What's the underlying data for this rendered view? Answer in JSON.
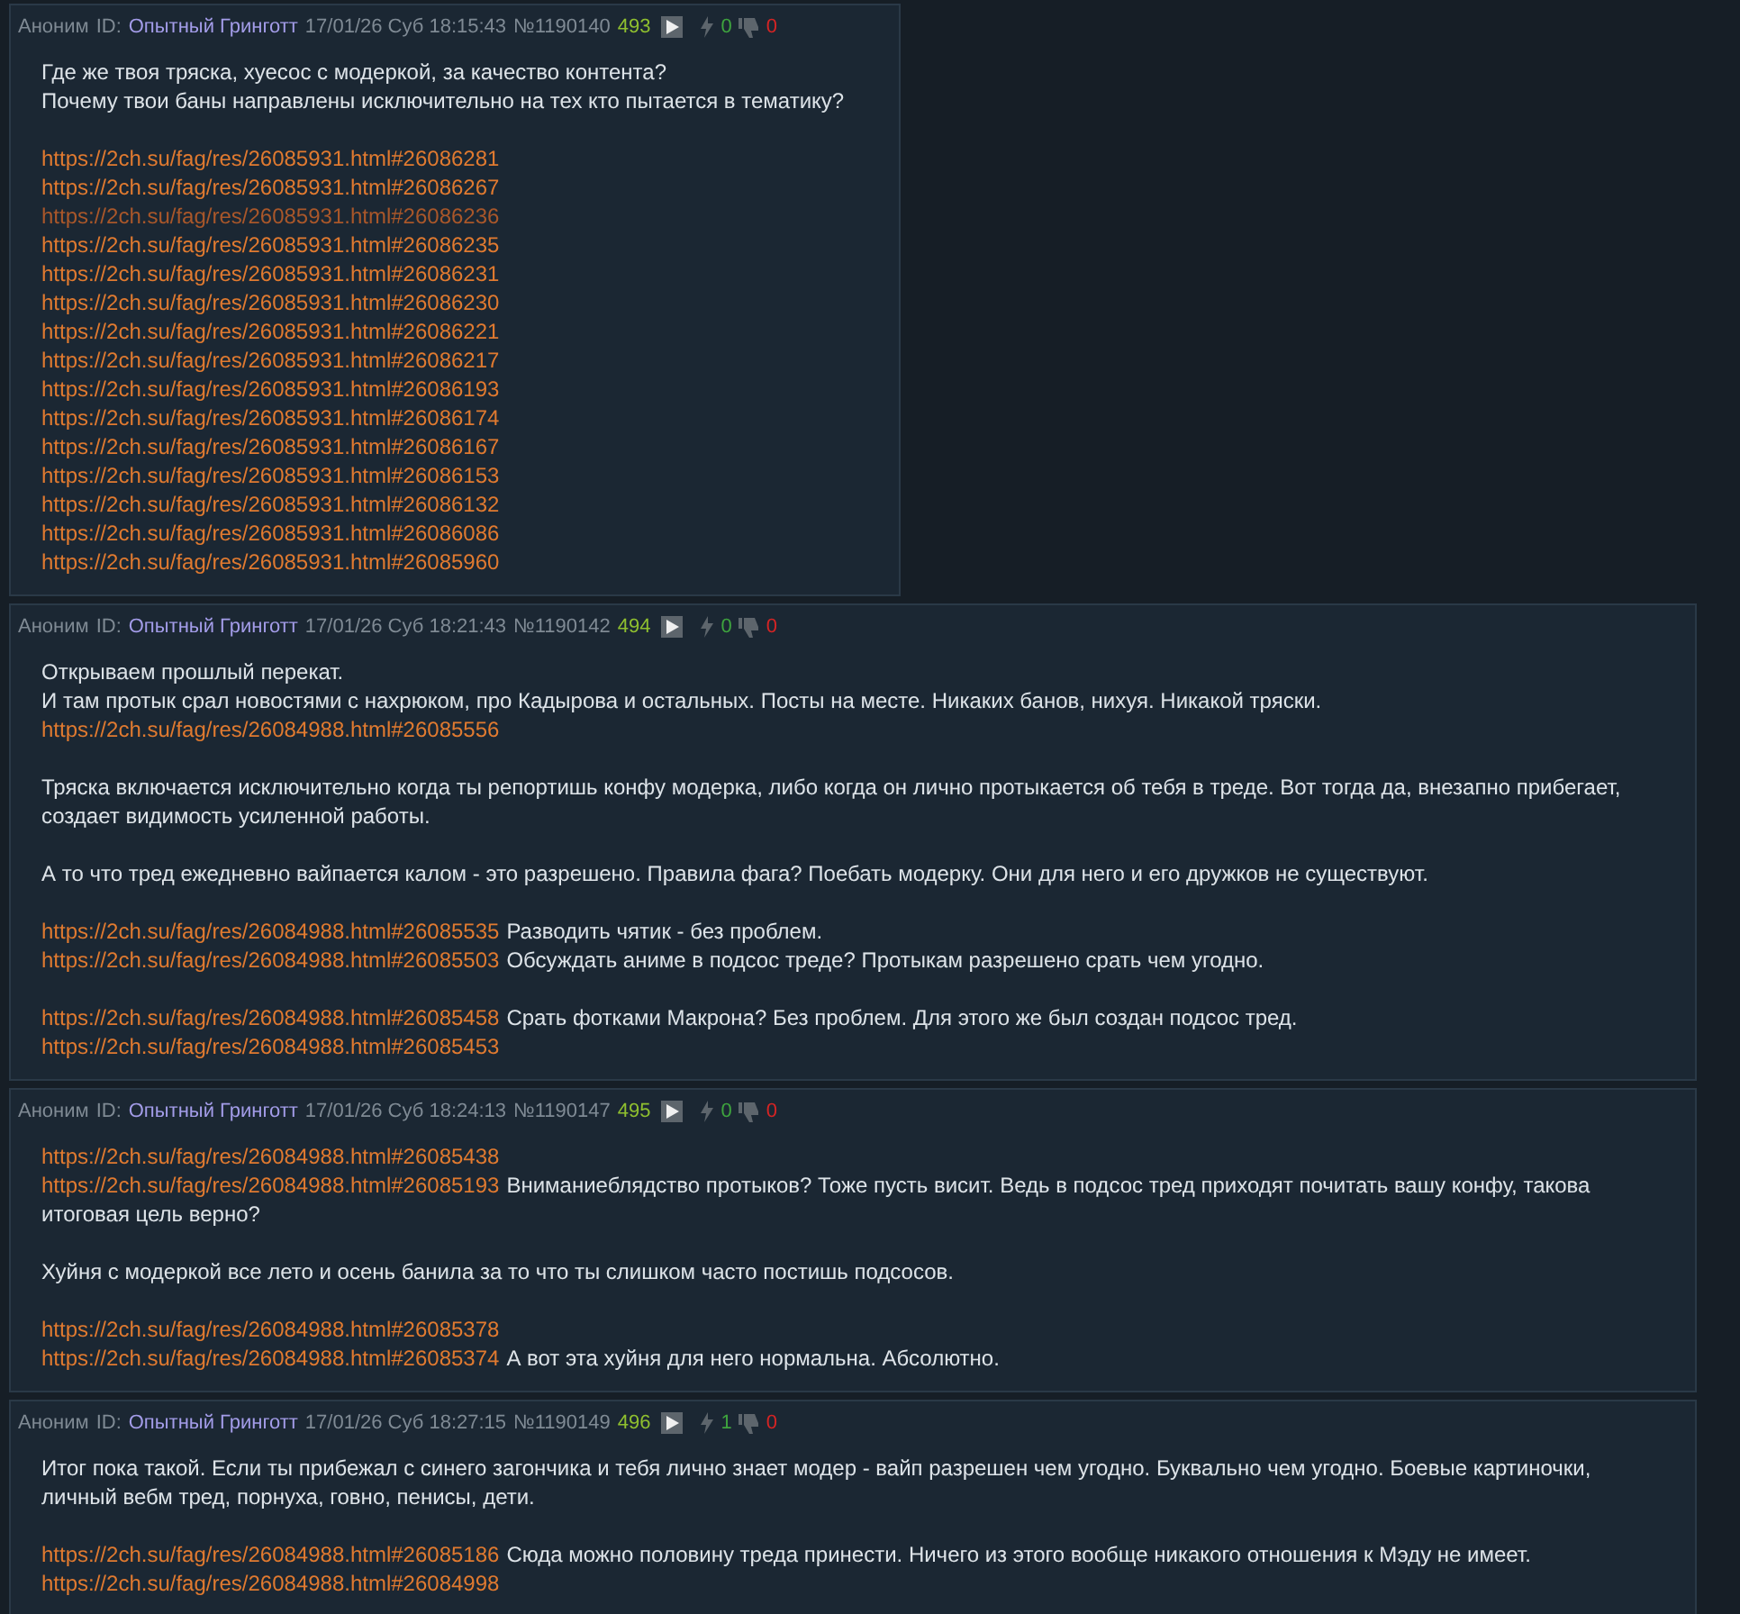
{
  "posts": [
    {
      "author": "Аноним",
      "id_label": "ID:",
      "id_name": "Опытный Гринготт",
      "date": "17/01/26 Суб 18:15:43",
      "number": "№1190140",
      "index": "493",
      "likes": "0",
      "dislikes": "0",
      "paragraphs": [
        [
          {
            "text": "Где же твоя тряска, хуесос с модеркой, за качество контента?"
          },
          {
            "text": "Почему твои баны направлены исключительно на тех кто пытается в тематику?"
          }
        ],
        [
          {
            "link": "https://2ch.su/fag/res/26085931.html#26086281",
            "visited": false
          },
          {
            "link": "https://2ch.su/fag/res/26085931.html#26086267",
            "visited": false
          },
          {
            "link": "https://2ch.su/fag/res/26085931.html#26086236",
            "visited": true
          },
          {
            "link": "https://2ch.su/fag/res/26085931.html#26086235",
            "visited": false
          },
          {
            "link": "https://2ch.su/fag/res/26085931.html#26086231",
            "visited": false
          },
          {
            "link": "https://2ch.su/fag/res/26085931.html#26086230",
            "visited": false
          },
          {
            "link": "https://2ch.su/fag/res/26085931.html#26086221",
            "visited": false
          },
          {
            "link": "https://2ch.su/fag/res/26085931.html#26086217",
            "visited": false
          },
          {
            "link": "https://2ch.su/fag/res/26085931.html#26086193",
            "visited": false
          },
          {
            "link": "https://2ch.su/fag/res/26085931.html#26086174",
            "visited": false
          },
          {
            "link": "https://2ch.su/fag/res/26085931.html#26086167",
            "visited": false
          },
          {
            "link": "https://2ch.su/fag/res/26085931.html#26086153",
            "visited": false
          },
          {
            "link": "https://2ch.su/fag/res/26085931.html#26086132",
            "visited": false
          },
          {
            "link": "https://2ch.su/fag/res/26085931.html#26086086",
            "visited": false
          },
          {
            "link": "https://2ch.su/fag/res/26085931.html#26085960",
            "visited": false
          }
        ]
      ]
    },
    {
      "author": "Аноним",
      "id_label": "ID:",
      "id_name": "Опытный Гринготт",
      "date": "17/01/26 Суб 18:21:43",
      "number": "№1190142",
      "index": "494",
      "likes": "0",
      "dislikes": "0",
      "paragraphs": [
        [
          {
            "text": "Открываем прошлый перекат."
          },
          {
            "text": "И там протык срал новостями с нахрюком, про Кадырова и остальных. Посты на месте. Никаких банов, нихуя. Никакой тряски."
          },
          {
            "link": "https://2ch.su/fag/res/26084988.html#26085556",
            "visited": false
          }
        ],
        [
          {
            "text": "Тряска включается исключительно когда ты репортишь конфу модерка, либо когда он лично протыкается об тебя в треде. Вот тогда да, внезапно прибегает, создает видимость усиленной работы."
          }
        ],
        [
          {
            "text": "А то что тред ежедневно вайпается калом - это разрешено. Правила фага? Поебать модерку. Они для него и его дружков не существуют."
          }
        ],
        [
          {
            "link": "https://2ch.su/fag/res/26084988.html#26085535",
            "visited": false,
            "text": "Разводить чятик - без проблем."
          },
          {
            "link": "https://2ch.su/fag/res/26084988.html#26085503",
            "visited": false,
            "text": "Обсуждать аниме в подсос треде? Протыкам разрешено срать чем угодно."
          }
        ],
        [
          {
            "link": "https://2ch.su/fag/res/26084988.html#26085458",
            "visited": false,
            "text": "Срать фотками Макрона? Без проблем. Для этого же был создан подсос тред."
          },
          {
            "link": "https://2ch.su/fag/res/26084988.html#26085453",
            "visited": false
          }
        ]
      ]
    },
    {
      "author": "Аноним",
      "id_label": "ID:",
      "id_name": "Опытный Гринготт",
      "date": "17/01/26 Суб 18:24:13",
      "number": "№1190147",
      "index": "495",
      "likes": "0",
      "dislikes": "0",
      "paragraphs": [
        [
          {
            "link": "https://2ch.su/fag/res/26084988.html#26085438",
            "visited": false
          },
          {
            "link": "https://2ch.su/fag/res/26084988.html#26085193",
            "visited": false,
            "text": "Вниманиеблядство протыков? Тоже пусть висит. Ведь в подсос тред приходят почитать вашу конфу, такова итоговая цель верно?"
          }
        ],
        [
          {
            "text": "Хуйня с модеркой все лето и осень банила за то что ты слишком часто постишь подсосов."
          }
        ],
        [
          {
            "link": "https://2ch.su/fag/res/26084988.html#26085378",
            "visited": false
          },
          {
            "link": "https://2ch.su/fag/res/26084988.html#26085374",
            "visited": false,
            "text": "А вот эта хуйня для него нормальна. Абсолютно."
          }
        ]
      ]
    },
    {
      "author": "Аноним",
      "id_label": "ID:",
      "id_name": "Опытный Гринготт",
      "date": "17/01/26 Суб 18:27:15",
      "number": "№1190149",
      "index": "496",
      "likes": "1",
      "dislikes": "0",
      "paragraphs": [
        [
          {
            "text": "Итог пока такой. Если ты прибежал с синего загончика и тебя лично знает модер - вайп разрешен чем угодно. Буквально чем угодно. Боевые картиночки, личный вебм тред, порнуха, говно, пенисы, дети."
          }
        ],
        [
          {
            "link": "https://2ch.su/fag/res/26084988.html#26085186",
            "visited": false,
            "text": "Сюда можно половину треда принести. Ничего из этого вообще никакого отношения к Мэду не имеет."
          },
          {
            "link": "https://2ch.su/fag/res/26084988.html#26084998",
            "visited": false
          }
        ]
      ]
    }
  ]
}
